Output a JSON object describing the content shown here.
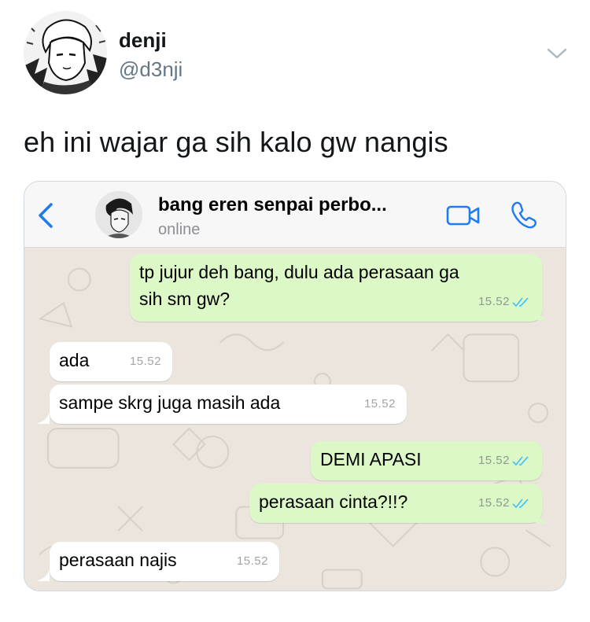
{
  "tweet": {
    "display_name": "denji",
    "handle": "@d3nji",
    "text": "eh ini wajar ga sih kalo gw nangis"
  },
  "chat": {
    "contact_name": "bang eren senpai perbo...",
    "contact_status": "online",
    "messages": [
      {
        "direction": "outgoing",
        "text_line1": "tp jujur deh bang, dulu ada perasaan ga",
        "text_line2": "sih sm gw?",
        "time": "15.52",
        "read": true
      },
      {
        "direction": "incoming",
        "text": "ada",
        "time": "15.52"
      },
      {
        "direction": "incoming",
        "text": "sampe skrg juga masih ada",
        "time": "15.52"
      },
      {
        "direction": "outgoing",
        "text": "DEMI APASI",
        "time": "15.52",
        "read": true
      },
      {
        "direction": "outgoing",
        "text": "perasaan cinta?!!?",
        "time": "15.52",
        "read": true
      },
      {
        "direction": "incoming",
        "text": "perasaan najis",
        "time": "15.52"
      }
    ]
  },
  "colors": {
    "ios_blue": "#1e7cf2",
    "outgoing_bubble": "#dcf8c6",
    "incoming_bubble": "#ffffff",
    "chat_background": "#ece5dd",
    "read_ticks": "#4fc3f7"
  },
  "icons": [
    "profile-avatar-icon",
    "chevron-down-icon",
    "back-chevron-icon",
    "contact-avatar-icon",
    "video-call-icon",
    "phone-call-icon",
    "double-check-icon"
  ]
}
